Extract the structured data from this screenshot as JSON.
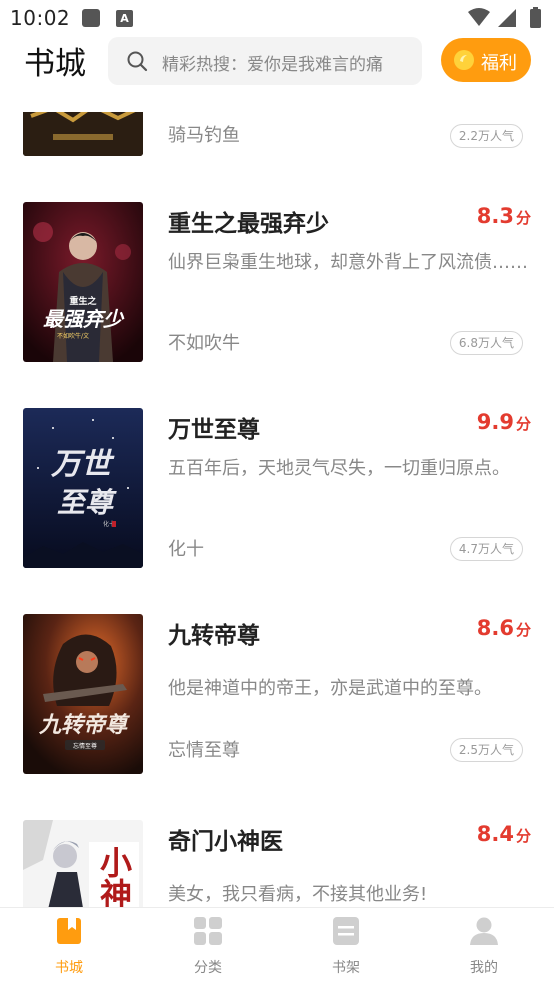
{
  "status_bar": {
    "time": "10:02",
    "a_badge": "A"
  },
  "header": {
    "title": "书城",
    "search_placeholder": "精彩热搜：爱你是我难言的痛",
    "welfare_label": "福利"
  },
  "books": [
    {
      "title": "",
      "score": "",
      "score_unit": "",
      "desc": "",
      "author": "骑马钓鱼",
      "popularity": "2.2万人气"
    },
    {
      "title": "重生之最强弃少",
      "score": "8.3",
      "score_unit": "分",
      "desc": "仙界巨枭重生地球，却意外背上了风流债……",
      "author": "不如吹牛",
      "popularity": "6.8万人气"
    },
    {
      "title": "万世至尊",
      "score": "9.9",
      "score_unit": "分",
      "desc": "五百年后，天地灵气尽失，一切重归原点。",
      "author": "化十",
      "popularity": "4.7万人气"
    },
    {
      "title": "九转帝尊",
      "score": "8.6",
      "score_unit": "分",
      "desc": "他是神道中的帝王，亦是武道中的至尊。",
      "author": "忘情至尊",
      "popularity": "2.5万人气"
    },
    {
      "title": "奇门小神医",
      "score": "8.4",
      "score_unit": "分",
      "desc": "美女，我只看病，不接其他业务!",
      "author": "",
      "popularity": ""
    }
  ],
  "covers": {
    "book1": {
      "line1": "重生之",
      "line2": "最强弃少",
      "line3": "不如吹牛/文"
    },
    "book2": {
      "line1": "万世",
      "line2": "至尊",
      "line3": "化十"
    },
    "book3": {
      "line1": "九转帝尊",
      "line2": "忘情至尊"
    },
    "book4": {
      "line1": "小神"
    }
  },
  "bottom_nav": [
    {
      "label": "书城",
      "icon": "bookstore-icon",
      "active": true
    },
    {
      "label": "分类",
      "icon": "category-icon",
      "active": false
    },
    {
      "label": "书架",
      "icon": "bookshelf-icon",
      "active": false
    },
    {
      "label": "我的",
      "icon": "profile-icon",
      "active": false
    }
  ],
  "colors": {
    "accent": "#ff9c0f",
    "score": "#e33b2f",
    "muted": "#888888"
  }
}
